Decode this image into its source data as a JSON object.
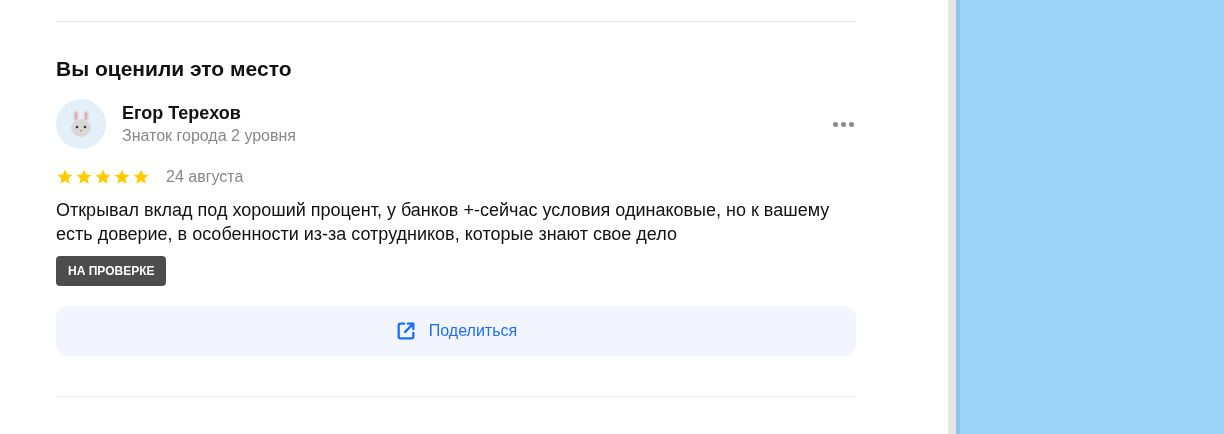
{
  "section_title": "Вы оценили это место",
  "review": {
    "author": "Егор Терехов",
    "author_level": "Знаток города 2 уровня",
    "stars": 5,
    "date": "24 августа",
    "text": "Открывал вклад под хороший процент, у банков +-сейчас условия одинаковые, но к вашему есть доверие, в особенности из-за сотрудников, которые знают свое дело",
    "status_badge": "НА ПРОВЕРКЕ"
  },
  "share_button": "Поделиться"
}
